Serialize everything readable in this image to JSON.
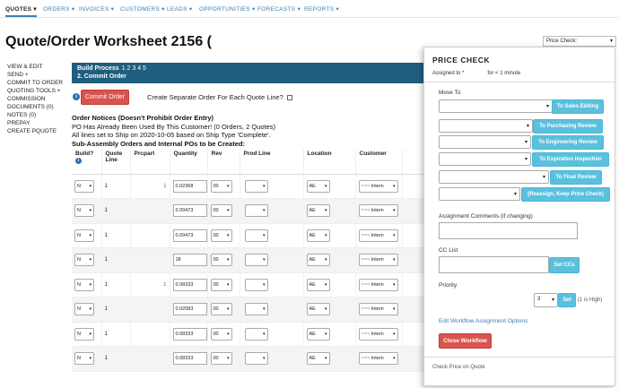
{
  "topnav": {
    "items": [
      {
        "label": "Quotes ▾",
        "active": true
      },
      {
        "label": "Orders ▾"
      },
      {
        "label": "Invoices ▾"
      },
      {
        "label": "Customers ▾"
      },
      {
        "label": "Leads ▾"
      },
      {
        "label": "Opportunities ▾"
      },
      {
        "label": "Forecasts ▾"
      },
      {
        "label": "Reports ▾"
      }
    ]
  },
  "page": {
    "title": "Quote/Order Worksheet 2156 (",
    "title_close": "",
    "price_check_select": "Price Check:"
  },
  "leftnav": [
    "View & Edit",
    "Send +",
    "Commit to Order",
    "Quoting Tools +",
    "Commission",
    "Documents (0)",
    "Notes (0)",
    "Prepay",
    "Create PQuote"
  ],
  "banner": {
    "line1": "Build Process",
    "steps": "1 2 3 4 5",
    "line2": "2. Commit Order"
  },
  "commit": {
    "button": "Commit Order",
    "separate_label": "Create Separate Order For Each Quote Line?"
  },
  "notices": {
    "title": "Order Notices (Doesn't Prohibit Order Entry)",
    "line1": "PO Has Already Been Used By This Customer! (0 Orders, 2 Quotes)",
    "line2": "All lines set to Ship on 2020-10-05 based on Ship Type 'Complete'.",
    "line3": "Sub-Assembly Orders and Internal POs to be Created:"
  },
  "table": {
    "headers": [
      "Build?",
      "Quote Line",
      "Prcpart",
      "Quantity",
      "Rev",
      "Prod Line",
      "Location",
      "Customer"
    ],
    "rows": [
      {
        "build": "N",
        "line": "1",
        "prcpart": "1",
        "qty": "0.02368",
        "rev": "00",
        "loc": "AE",
        "cust": "~~~ Intern"
      },
      {
        "build": "N",
        "line": "1",
        "prcpart": "",
        "qty": "0.09473",
        "rev": "00",
        "loc": "AE",
        "cust": "~~~ Intern"
      },
      {
        "build": "N",
        "line": "1",
        "prcpart": "",
        "qty": "0.09473",
        "rev": "00",
        "loc": "AE",
        "cust": "~~~ Intern"
      },
      {
        "build": "N",
        "line": "1",
        "prcpart": "",
        "qty": "18",
        "rev": "00",
        "loc": "AE",
        "cust": "~~~ Intern"
      },
      {
        "build": "N",
        "line": "1",
        "prcpart": "1",
        "qty": "0.08333",
        "rev": "00",
        "loc": "AE",
        "cust": "~~~ Intern"
      },
      {
        "build": "N",
        "line": "1",
        "prcpart": "",
        "qty": "0.02083",
        "rev": "00",
        "loc": "AE",
        "cust": "~~~ Intern"
      },
      {
        "build": "N",
        "line": "1",
        "prcpart": "",
        "qty": "0.08333",
        "rev": "00",
        "loc": "AE",
        "cust": "~~~ Intern"
      },
      {
        "build": "N",
        "line": "1",
        "prcpart": "",
        "qty": "0.08333",
        "rev": "00",
        "loc": "AE",
        "cust": "~~~ Intern"
      }
    ]
  },
  "panel": {
    "title": "PRICE CHECK",
    "assigned_label": "Assigned to *",
    "assigned_value": "for < 1 minute",
    "move_to": "Move To",
    "buttons": [
      "To Sales Editing",
      "To Purchasing Review",
      "To Engineering Review",
      "To Expiration Inspection",
      "To Final Review",
      "(Reassign, Keep Price Check)"
    ],
    "comments_label": "Assignment Comments (if changing)",
    "cc_label": "CC List",
    "cc_button": "Set CCs",
    "priority_label": "Priority",
    "priority_value": "3",
    "priority_button": "Set",
    "priority_hint": "(1 is High)",
    "edit_link": "Edit Workflow Assignment Options",
    "close_button": "Close Workflow",
    "footer": "Check Price on Quote"
  }
}
